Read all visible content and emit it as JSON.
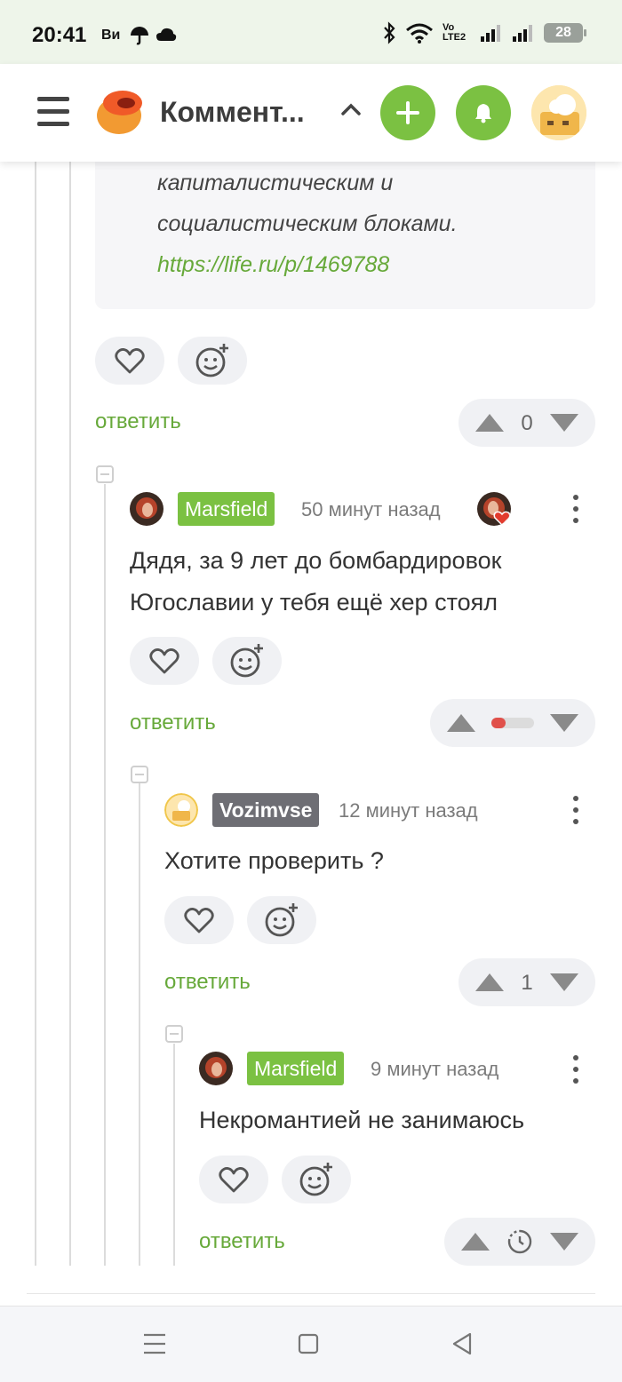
{
  "status_bar": {
    "time": "20:41",
    "carrier": "Ви",
    "lte_text": "Vo LTE2",
    "battery": "28"
  },
  "app_bar": {
    "title": "Коммент...",
    "accent_color": "#7bc142"
  },
  "quote": {
    "line1": "капиталистическим и",
    "line2": "социалистическим блоками.",
    "link": "https://life.ru/p/1469788"
  },
  "reply_label": "ответить",
  "first_block": {
    "score": "0"
  },
  "comments": [
    {
      "author": "Marsfield",
      "time": "50 минут назад",
      "text_line1": "Дядя, за 9 лет до бомбардировок",
      "text_line2": "Югославии у тебя ещё хер стоял",
      "score_display": "rating-bar"
    },
    {
      "author": "Vozimvse",
      "time": "12 минут назад",
      "text_line1": "Хотите проверить ?",
      "score": "1"
    },
    {
      "author": "Marsfield",
      "time": "9 минут назад",
      "text_line1": "Некромантией не занимаюсь",
      "score_display": "pending-clock"
    }
  ]
}
